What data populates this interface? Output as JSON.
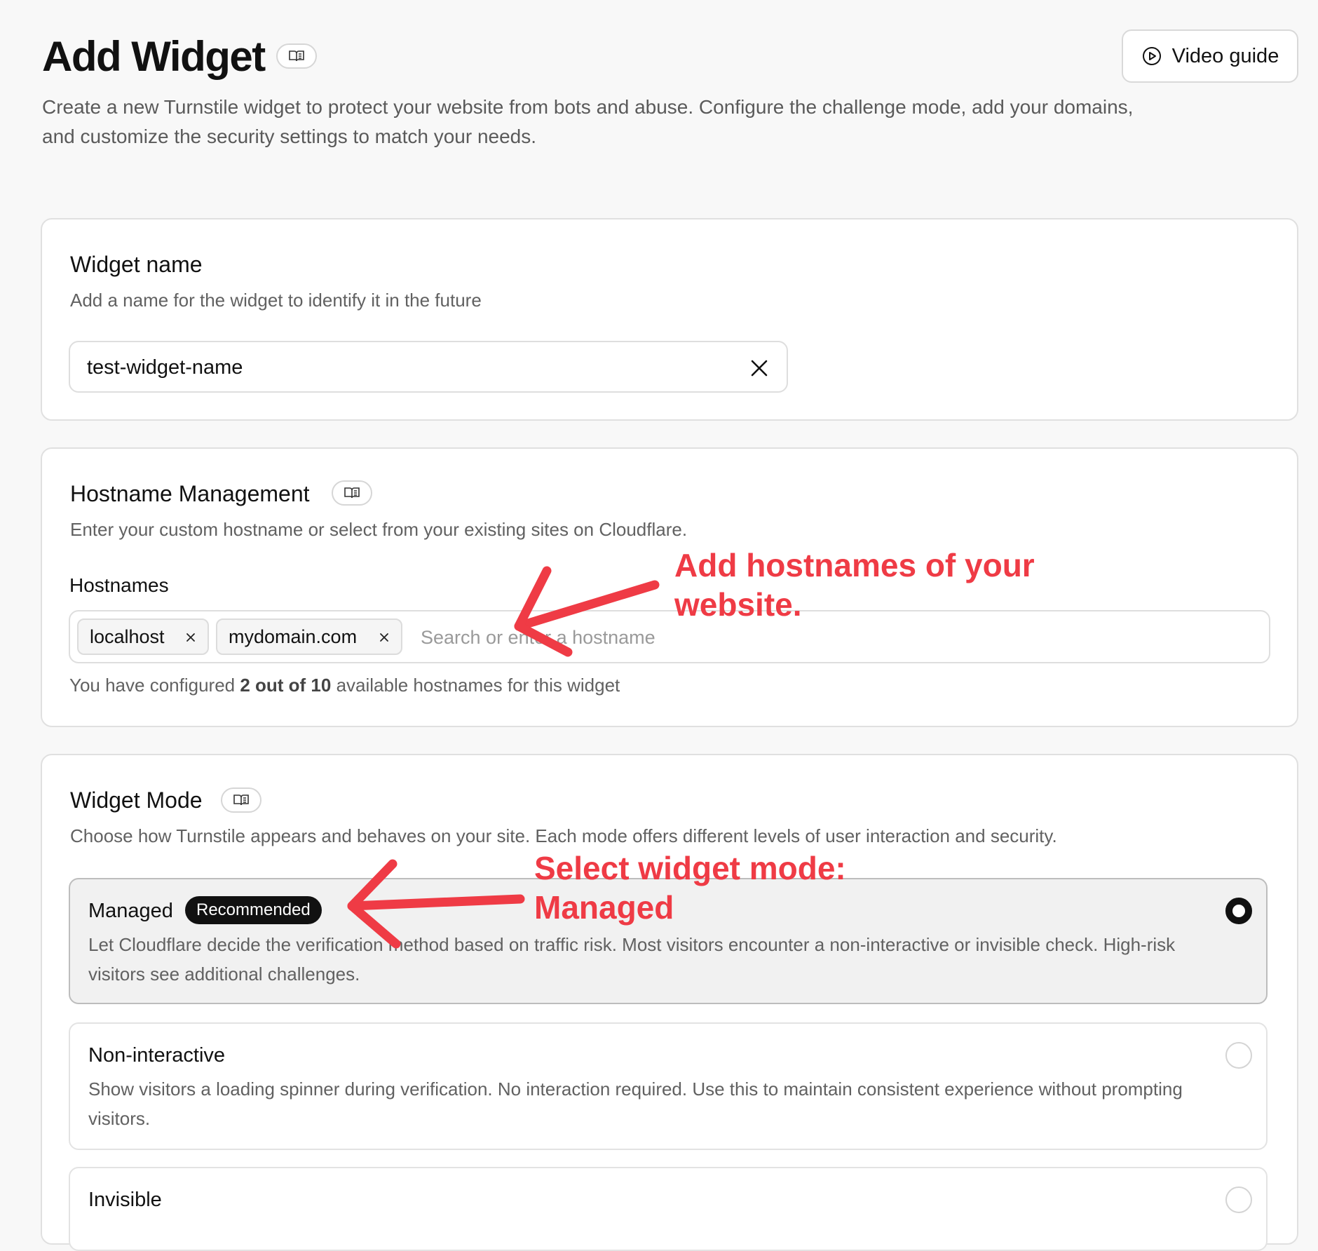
{
  "header": {
    "title": "Add Widget",
    "video_guide_label": "Video guide",
    "description": "Create a new Turnstile widget to protect your website from bots and abuse. Configure the challenge mode, add your domains, and customize the security settings to match your needs."
  },
  "widget_name": {
    "title": "Widget name",
    "description": "Add a name for the widget to identify it in the future",
    "value": "test-widget-name"
  },
  "hostname_management": {
    "title": "Hostname Management",
    "description": "Enter your custom hostname or select from your existing sites on Cloudflare.",
    "field_label": "Hostnames",
    "chips": [
      "localhost",
      "mydomain.com"
    ],
    "search_placeholder": "Search or enter a hostname",
    "note_prefix": "You have configured ",
    "note_count": "2 out of 10",
    "note_suffix": " available hostnames for this widget"
  },
  "widget_mode": {
    "title": "Widget Mode",
    "description": "Choose how Turnstile appears and behaves on your site. Each mode offers different levels of user interaction and security.",
    "options": [
      {
        "label": "Managed",
        "badge": "Recommended",
        "description": "Let Cloudflare decide the verification method based on traffic risk. Most visitors encounter a non-interactive or invisible check. High-risk visitors see additional challenges.",
        "selected": true
      },
      {
        "label": "Non-interactive",
        "description": "Show visitors a loading spinner during verification. No interaction required. Use this to maintain consistent experience without prompting visitors.",
        "selected": false
      },
      {
        "label": "Invisible",
        "selected": false
      }
    ]
  },
  "annotations": {
    "hostnames_line1": "Add hostnames of your",
    "hostnames_line2": "website.",
    "mode_line1": "Select widget mode:",
    "mode_line2": "Managed"
  },
  "colors": {
    "annotation": "#ef3b45",
    "background": "#f8f8f8",
    "badge": "#111111"
  },
  "icons": {
    "doc": "book-open-icon",
    "video": "play-circle-icon",
    "clear": "close-icon"
  }
}
